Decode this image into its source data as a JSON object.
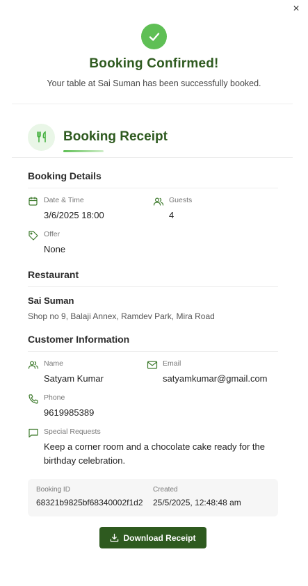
{
  "close_label": "×",
  "header": {
    "title": "Booking Confirmed!",
    "subtitle": "Your table at Sai Suman has been successfully booked."
  },
  "receipt": {
    "title": "Booking Receipt"
  },
  "booking_details": {
    "title": "Booking Details",
    "date_label": "Date & Time",
    "date_value": "3/6/2025 18:00",
    "guests_label": "Guests",
    "guests_value": "4",
    "offer_label": "Offer",
    "offer_value": "None"
  },
  "restaurant": {
    "title": "Restaurant",
    "name": "Sai Suman",
    "address": "Shop no 9, Balaji Annex, Ramdev Park, Mira Road"
  },
  "customer": {
    "title": "Customer Information",
    "name_label": "Name",
    "name_value": "Satyam Kumar",
    "email_label": "Email",
    "email_value": "satyamkumar@gmail.com",
    "phone_label": "Phone",
    "phone_value": "9619985389",
    "requests_label": "Special Requests",
    "requests_value": "Keep a corner room and a chocolate cake ready for the birthday celebration."
  },
  "meta": {
    "booking_id_label": "Booking ID",
    "booking_id_value": "68321b9825bf68340002f1d2",
    "created_label": "Created",
    "created_value": "25/5/2025, 12:48:48 am"
  },
  "download_label": "Download Receipt",
  "colors": {
    "brand": "#2e5a1f",
    "accent": "#5fbf55",
    "icon": "#3d7a2c"
  }
}
